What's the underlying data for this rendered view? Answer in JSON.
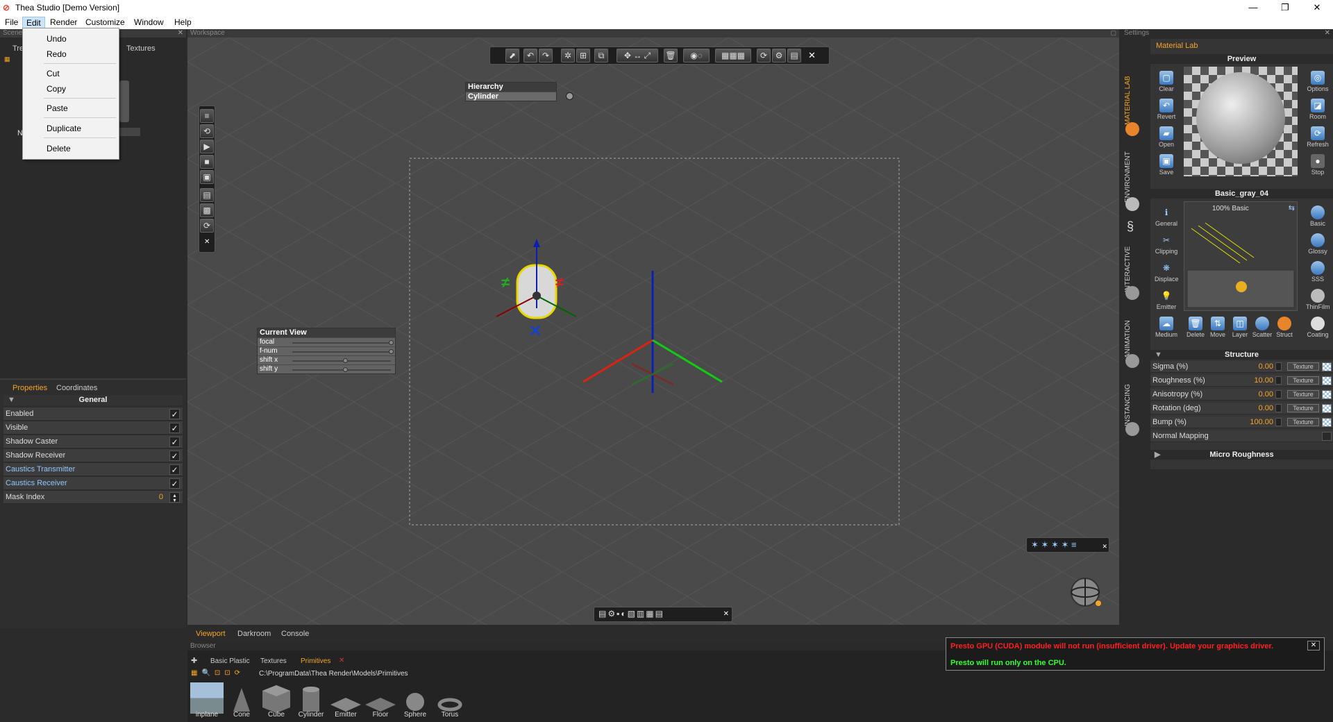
{
  "window": {
    "title": "Thea Studio [Demo Version]",
    "minimize": "—",
    "maximize": "❐",
    "close": "✕"
  },
  "menubar": {
    "file": "File",
    "edit": "Edit",
    "render": "Render",
    "customize": "Customize",
    "window": "Window",
    "help": "Help"
  },
  "edit_menu": {
    "undo": "Undo",
    "redo": "Redo",
    "cut": "Cut",
    "copy": "Copy",
    "paste": "Paste",
    "duplicate": "Duplicate",
    "delete": "Delete"
  },
  "scene_panel": {
    "header": "Scene",
    "tab_tree": "Tre",
    "tab_textures": "Textures",
    "row_prefix": "N"
  },
  "properties": {
    "tab_properties": "Properties",
    "tab_coordinates": "Coordinates",
    "section": "General",
    "rows": [
      {
        "label": "Enabled",
        "checked": true
      },
      {
        "label": "Visible",
        "checked": true
      },
      {
        "label": "Shadow Caster",
        "checked": true
      },
      {
        "label": "Shadow Receiver",
        "checked": true
      },
      {
        "label": "Caustics Transmitter",
        "checked": true
      },
      {
        "label": "Caustics Receiver",
        "checked": true
      }
    ],
    "mask_label": "Mask Index",
    "mask_value": "0"
  },
  "workspace": {
    "header": "Workspace"
  },
  "hierarchy": {
    "title": "Hierarchy",
    "item": "Cylinder"
  },
  "current_view": {
    "title": "Current View",
    "rows": [
      "focal",
      "f-num",
      "shift x",
      "shift y"
    ]
  },
  "bottom_tabs": {
    "viewport": "Viewport",
    "darkroom": "Darkroom",
    "console": "Console"
  },
  "browser": {
    "header": "Browser",
    "tabs": [
      "Basic Plastic",
      "Textures",
      "Primitives"
    ],
    "path": "C:\\ProgramData\\Thea Render\\Models\\Primitives",
    "items": [
      "inplane",
      "Cone",
      "Cube",
      "Cylinder",
      "Emitter",
      "Floor",
      "Sphere",
      "Torus"
    ]
  },
  "settings": {
    "header": "Settings",
    "side_tabs": [
      "MATERIAL LAB",
      "ENVIRONMENT",
      "INTERACTIVE",
      "ANIMATION",
      "INSTANCING"
    ],
    "material_lab": "Material Lab",
    "preview": "Preview",
    "preview_left": [
      "Clear",
      "Revert",
      "Open",
      "Save"
    ],
    "preview_right": [
      "Options",
      "Room",
      "Refresh",
      "Stop"
    ],
    "material_name": "Basic_gray_04",
    "layer_label": "100% Basic",
    "left_icons": [
      "General",
      "Clipping",
      "Displace",
      "Emitter",
      "Medium"
    ],
    "right_icons": [
      "Basic",
      "Glossy",
      "SSS",
      "ThinFilm",
      "Coating"
    ],
    "bottom_icons": [
      "Delete",
      "Move",
      "Layer",
      "Scatter",
      "Struct"
    ],
    "structure_title": "Structure",
    "structure_rows": [
      {
        "label": "Sigma (%)",
        "value": "0.00"
      },
      {
        "label": "Roughness (%)",
        "value": "10.00"
      },
      {
        "label": "Anisotropy (%)",
        "value": "0.00"
      },
      {
        "label": "Rotation (deg)",
        "value": "0.00"
      },
      {
        "label": "Bump (%)",
        "value": "100.00"
      }
    ],
    "texture_button": "Texture",
    "normal_mapping": "Normal Mapping",
    "micro_roughness": "Micro Roughness"
  },
  "presto": {
    "error": "Presto GPU (CUDA) module will not run (insufficient driver). Update your graphics driver.",
    "info": "Presto will run only on the CPU.",
    "close": "✕"
  },
  "colors": {
    "accent": "#f5a623",
    "error": "#ff2020",
    "ok": "#33ff33",
    "viewport_bg": "#4a4a4a"
  }
}
